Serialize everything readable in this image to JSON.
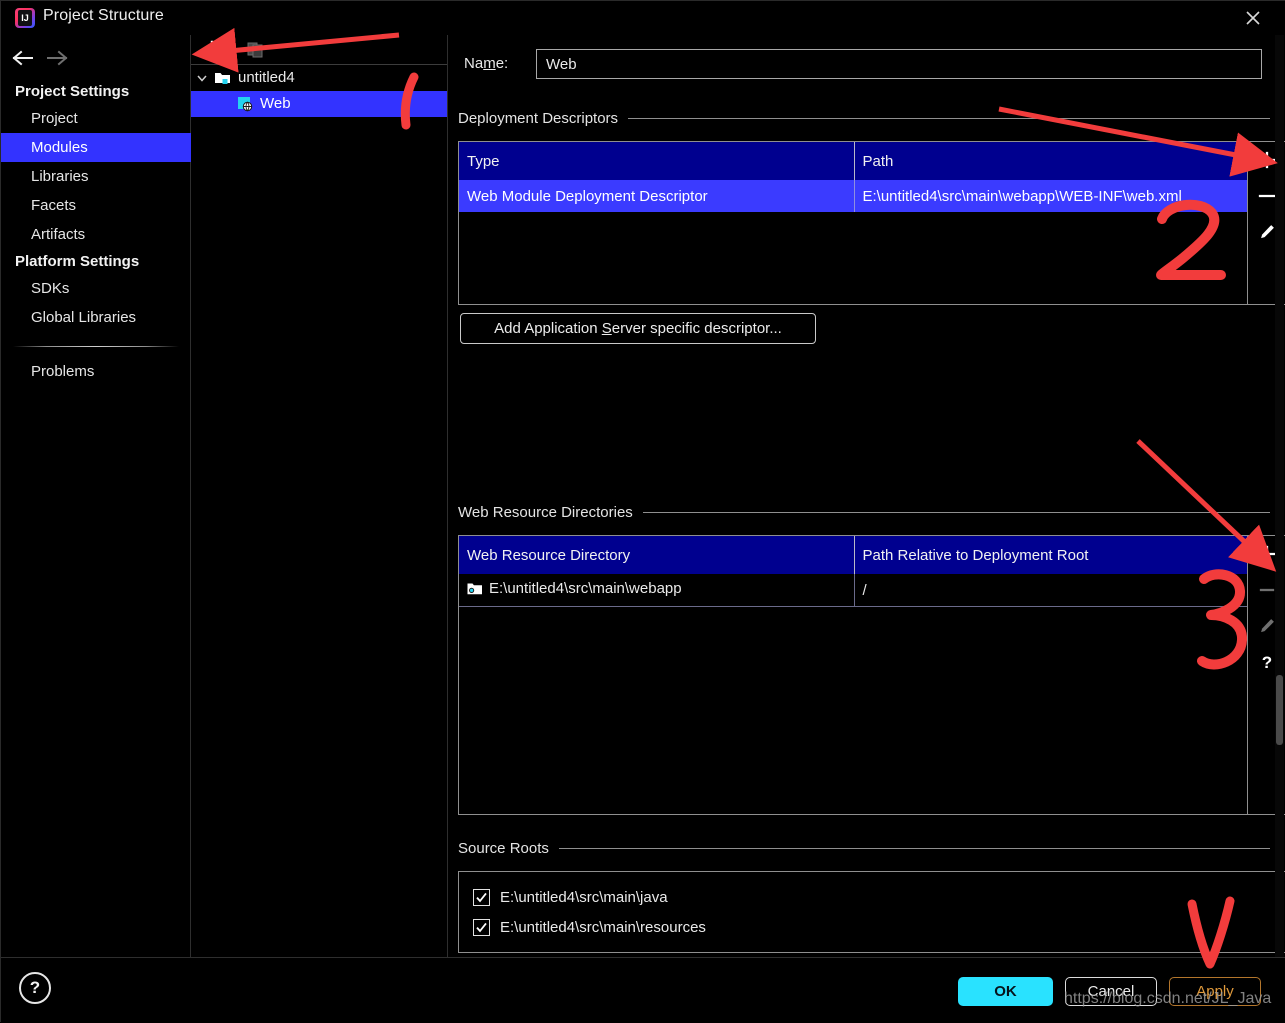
{
  "window": {
    "title": "Project Structure",
    "logo_letters": "IJ",
    "close_icon": "close-icon"
  },
  "sidebar": {
    "nav": {
      "back_icon": "arrow-left-icon",
      "forward_icon": "arrow-right-icon"
    },
    "groups": [
      {
        "title": "Project Settings",
        "items": [
          {
            "label": "Project",
            "selected": false
          },
          {
            "label": "Modules",
            "selected": true
          },
          {
            "label": "Libraries",
            "selected": false
          },
          {
            "label": "Facets",
            "selected": false
          },
          {
            "label": "Artifacts",
            "selected": false
          }
        ]
      },
      {
        "title": "Platform Settings",
        "items": [
          {
            "label": "SDKs",
            "selected": false
          },
          {
            "label": "Global Libraries",
            "selected": false
          }
        ]
      }
    ],
    "extra_items": [
      {
        "label": "Problems",
        "selected": false
      }
    ]
  },
  "tree_panel": {
    "toolbar": {
      "add_icon": "plus-icon",
      "copy_icon": "copy-module-icon"
    },
    "nodes": [
      {
        "label": "untitled4",
        "icon": "folder-module-icon",
        "expanded": true,
        "depth": 0,
        "selected": false
      },
      {
        "label": "Web",
        "icon": "web-facet-icon",
        "expanded": null,
        "depth": 1,
        "selected": true
      }
    ]
  },
  "main": {
    "name_field": {
      "label_before": "Na",
      "label_mnemonic": "m",
      "label_after": "e:",
      "value": "Web",
      "placeholder": ""
    },
    "deployment_descriptors": {
      "title": "Deployment Descriptors",
      "columns": [
        "Type",
        "Path"
      ],
      "rows": [
        {
          "type": "Web Module Deployment Descriptor",
          "path": "E:\\untitled4\\src\\main\\webapp\\WEB-INF\\web.xml",
          "selected": true
        }
      ],
      "toolbar": [
        {
          "name": "add-descriptor-button",
          "icon": "plus-icon",
          "enabled": true
        },
        {
          "name": "remove-descriptor-button",
          "icon": "minus-icon",
          "enabled": true
        },
        {
          "name": "edit-descriptor-button",
          "icon": "pencil-icon",
          "enabled": true
        }
      ],
      "add_button": {
        "before": "Add Application ",
        "mnemonic": "S",
        "after": "erver specific descriptor..."
      }
    },
    "web_resource_directories": {
      "title": "Web Resource Directories",
      "columns": [
        "Web Resource Directory",
        "Path Relative to Deployment Root"
      ],
      "rows": [
        {
          "directory": "E:\\untitled4\\src\\main\\webapp",
          "relative_path": "/",
          "icon": "folder-web-icon",
          "selected": false
        }
      ],
      "toolbar": [
        {
          "name": "add-web-resource-button",
          "icon": "plus-icon",
          "enabled": true
        },
        {
          "name": "remove-web-resource-button",
          "icon": "minus-icon",
          "enabled": false
        },
        {
          "name": "edit-web-resource-button",
          "icon": "pencil-icon",
          "enabled": false
        },
        {
          "name": "web-resource-help-button",
          "icon": "question-icon",
          "enabled": true
        }
      ]
    },
    "source_roots": {
      "title": "Source Roots",
      "items": [
        {
          "label": "E:\\untitled4\\src\\main\\java",
          "checked": true
        },
        {
          "label": "E:\\untitled4\\src\\main\\resources",
          "checked": true
        }
      ]
    }
  },
  "footer": {
    "help_icon": "question-mark-icon",
    "help_glyph": "?",
    "ok": "OK",
    "cancel": "Cancel",
    "apply": "Apply"
  },
  "watermark": "https://blog.csdn.net/JL_Java",
  "annotations": [
    {
      "name": "arrow-to-add-module",
      "kind": "arrow",
      "label": ""
    },
    {
      "name": "stroke-1-marker",
      "kind": "stroke",
      "label": "1"
    },
    {
      "name": "arrow-to-add-descriptor",
      "kind": "arrow",
      "label": ""
    },
    {
      "name": "marker-2",
      "kind": "digit",
      "label": "2"
    },
    {
      "name": "arrow-to-add-web-resource",
      "kind": "arrow",
      "label": ""
    },
    {
      "name": "marker-3",
      "kind": "digit",
      "label": "3"
    },
    {
      "name": "arrow-to-apply",
      "kind": "arrow",
      "label": ""
    }
  ],
  "colors": {
    "selection_blue": "#3333ff",
    "table_header_navy": "#00008f",
    "table_row_selected": "#3b3bff",
    "ok_cyan": "#29e2ff",
    "apply_orange": "#e09a3c",
    "annotation_red": "#f23c3c"
  }
}
